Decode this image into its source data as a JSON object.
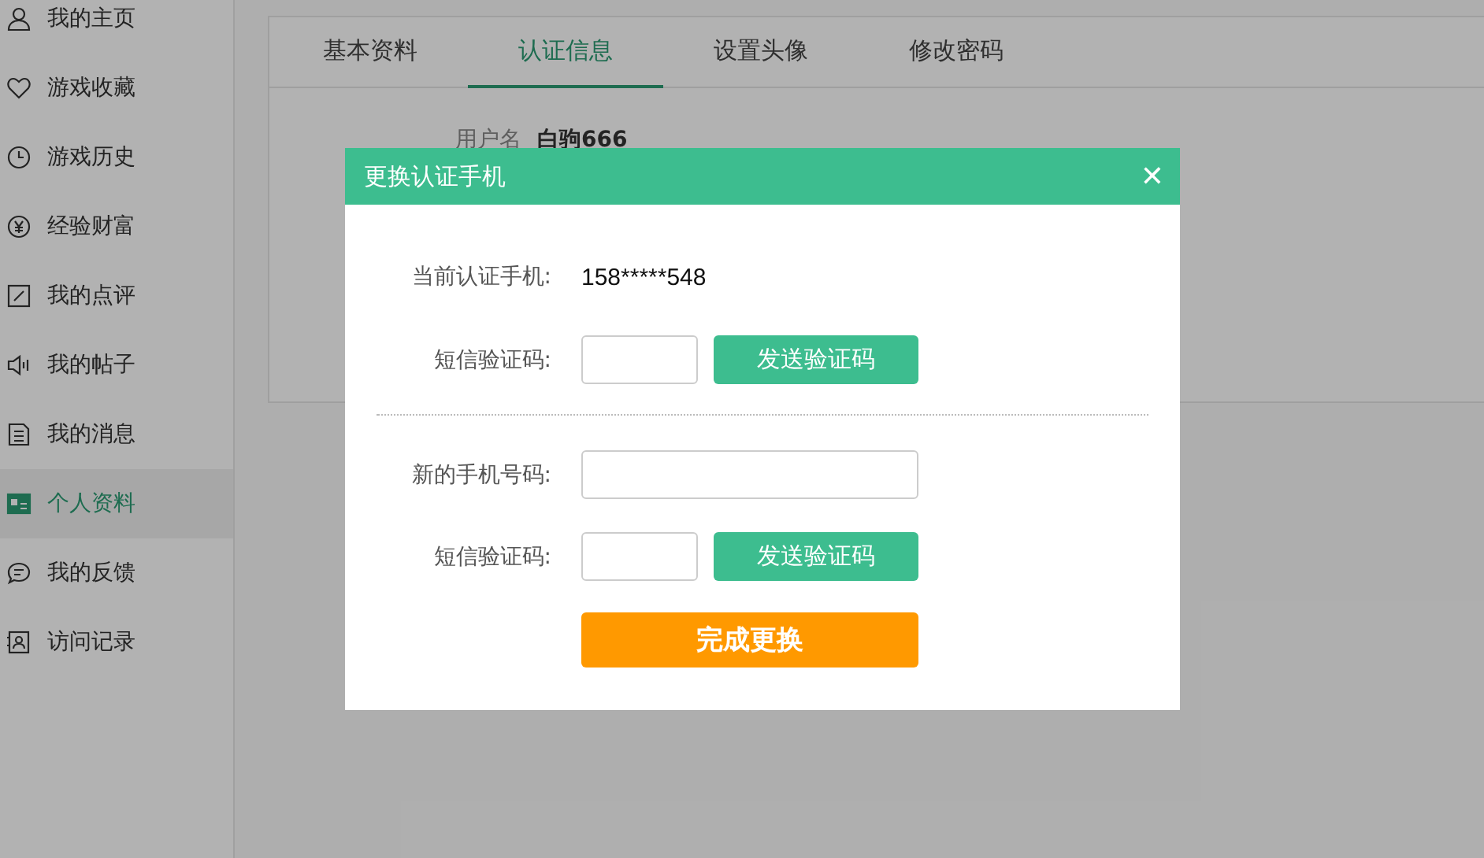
{
  "sidebar": {
    "items": [
      {
        "label": "我的主页",
        "selected": false
      },
      {
        "label": "游戏收藏",
        "selected": false
      },
      {
        "label": "游戏历史",
        "selected": false
      },
      {
        "label": "经验财富",
        "selected": false
      },
      {
        "label": "我的点评",
        "selected": false
      },
      {
        "label": "我的帖子",
        "selected": false
      },
      {
        "label": "我的消息",
        "selected": false
      },
      {
        "label": "个人资料",
        "selected": true
      },
      {
        "label": "我的反馈",
        "selected": false
      },
      {
        "label": "访问记录",
        "selected": false
      }
    ]
  },
  "tabs": [
    {
      "label": "基本资料",
      "selected": false
    },
    {
      "label": "认证信息",
      "selected": true
    },
    {
      "label": "设置头像",
      "selected": false
    },
    {
      "label": "修改密码",
      "selected": false
    }
  ],
  "profile": {
    "username_label": "用户名",
    "username": "白驹666"
  },
  "dialog": {
    "title": "更换认证手机",
    "close": "✕",
    "current_phone": {
      "label": "当前认证手机:",
      "value": "158*****548"
    },
    "rows": [
      {
        "kind": "code",
        "label": "短信验证码:",
        "button": "发送验证码"
      },
      {
        "kind": "divider"
      },
      {
        "kind": "phone",
        "label": "新的手机号码:"
      },
      {
        "kind": "code",
        "label": "短信验证码:",
        "button": "发送验证码"
      }
    ],
    "submit": "完成更换"
  }
}
